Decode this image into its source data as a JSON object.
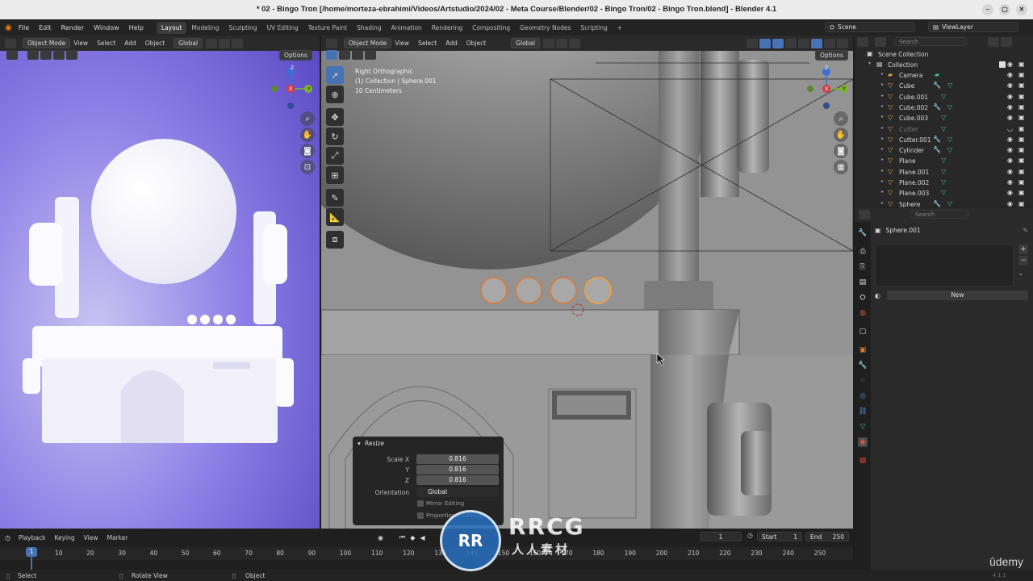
{
  "window": {
    "title": "* 02 - Bingo Tron [/home/morteza-ebrahimi/Videos/Artstudio/2024/02 - Meta Course/Blender/02 - Bingo Tron/02 - Bingo Tron.blend] - Blender 4.1",
    "minimize": "–",
    "maximize": "▢",
    "close": "✕"
  },
  "menubar": {
    "items": [
      "File",
      "Edit",
      "Render",
      "Window",
      "Help"
    ],
    "workspaces": [
      "Layout",
      "Modeling",
      "Sculpting",
      "UV Editing",
      "Texture Paint",
      "Shading",
      "Animation",
      "Rendering",
      "Compositing",
      "Geometry Nodes",
      "Scripting"
    ],
    "active_workspace": "Layout",
    "add_tab": "+",
    "scene": "Scene",
    "view_layer": "ViewLayer"
  },
  "left_viewport": {
    "mode": "Object Mode",
    "menus": [
      "View",
      "Select",
      "Add",
      "Object"
    ],
    "orientation": "Global",
    "options": "Options",
    "gizmo": {
      "z": "Z",
      "x": "X",
      "y": "Y"
    }
  },
  "main_viewport": {
    "mode": "Object Mode",
    "menus": [
      "View",
      "Select",
      "Add",
      "Object"
    ],
    "orientation": "Global",
    "options": "Options",
    "info_line1": "Right Orthographic",
    "info_line2": "(1) Collection | Sphere.001",
    "info_line3": "10 Centimeters",
    "gizmo": {
      "z": "Z",
      "x": "X",
      "y": "Y"
    }
  },
  "redo_panel": {
    "title": "Resize",
    "scale_x_label": "Scale X",
    "scale_x": "0.816",
    "y_label": "Y",
    "y": "0.816",
    "z_label": "Z",
    "z": "0.816",
    "orientation_label": "Orientation",
    "orientation": "Global",
    "mirror_editing": "Mirror Editing",
    "proportional_editing": "Proportional Editing"
  },
  "outliner": {
    "search_placeholder": "Search",
    "scene_collection": "Scene Collection",
    "collection": "Collection",
    "items": [
      {
        "name": "Camera",
        "type": "camera"
      },
      {
        "name": "Cube",
        "type": "mesh"
      },
      {
        "name": "Cube.001",
        "type": "mesh"
      },
      {
        "name": "Cube.002",
        "type": "mesh"
      },
      {
        "name": "Cube.003",
        "type": "mesh"
      },
      {
        "name": "Cutter",
        "type": "mesh",
        "hidden": true
      },
      {
        "name": "Cutter.001",
        "type": "mesh"
      },
      {
        "name": "Cylinder",
        "type": "mesh"
      },
      {
        "name": "Plane",
        "type": "mesh"
      },
      {
        "name": "Plane.001",
        "type": "mesh"
      },
      {
        "name": "Plane.002",
        "type": "mesh"
      },
      {
        "name": "Plane.003",
        "type": "mesh"
      },
      {
        "name": "Sphere",
        "type": "mesh"
      }
    ]
  },
  "properties": {
    "search_placeholder": "Search",
    "object_name": "Sphere.001",
    "new_button": "New"
  },
  "timeline": {
    "menus": [
      "Playback",
      "Keying",
      "View",
      "Marker"
    ],
    "current_frame": "1",
    "start_label": "Start",
    "start": "1",
    "end_label": "End",
    "end": "250",
    "ticks": [
      "10",
      "20",
      "30",
      "40",
      "50",
      "60",
      "70",
      "80",
      "90",
      "100",
      "110",
      "120",
      "130",
      "140",
      "150",
      "160",
      "170",
      "180",
      "190",
      "200",
      "210",
      "220",
      "230",
      "240",
      "250"
    ],
    "playhead": "1"
  },
  "statusbar": {
    "select": "Select",
    "rotate": "Rotate View",
    "object": "Object"
  },
  "watermark": {
    "brand": "RRCG",
    "subtitle": "人人素材",
    "udemy": "ûdemy",
    "version": "4.1.1"
  },
  "colors": {
    "accent": "#4772b3",
    "selected_outline": "#e0782e",
    "viewport_bg": "#8e8e8e",
    "render_bg": "#7a6ee0"
  }
}
